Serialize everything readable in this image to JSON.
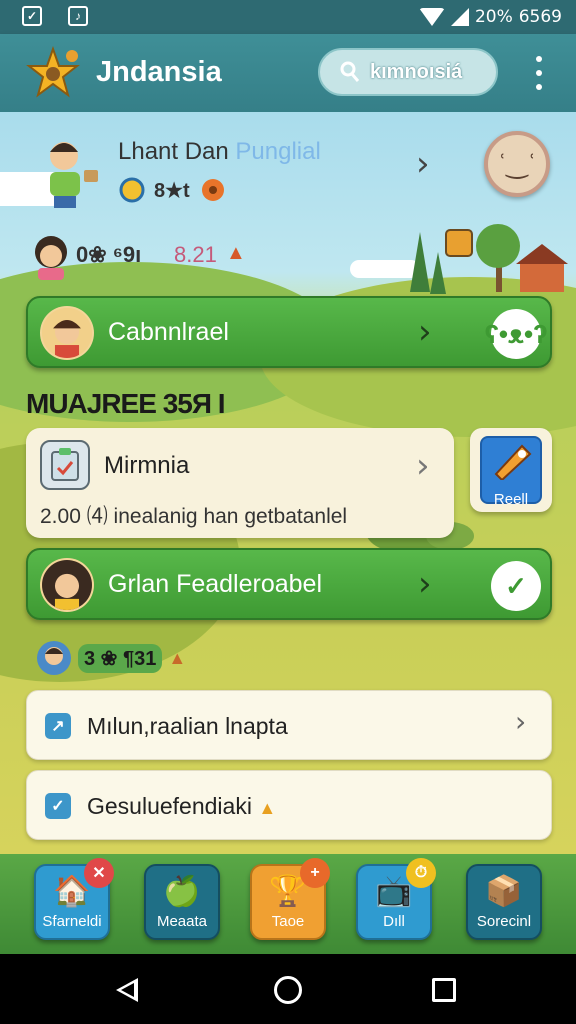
{
  "status_bar": {
    "left_icons": [
      "app-icon-a",
      "app-icon-b"
    ],
    "battery": "20%",
    "time": "6569"
  },
  "app_bar": {
    "title": "Jndansia",
    "search_label": "kımnoısiá",
    "menu_icon": "more-vert-icon"
  },
  "profile": {
    "name_main": "Lhant Dan ",
    "name_highlight": "Punglial",
    "badges_text": "8★t"
  },
  "row2": {
    "text": "0❀ ⁶9ı",
    "score": "8.21"
  },
  "cards": {
    "card1_label": "Cabnnlrael",
    "card2_label": "Grlan Feadleroabel"
  },
  "section_title": "MUAJREE 35Я I",
  "info_card": {
    "title": "Mirmnia",
    "description": "2.00 ⑷ inealanig han getbatanlel"
  },
  "side_tile": {
    "label": "Reell"
  },
  "row3": {
    "text": "3 ❀ ¶31"
  },
  "list": [
    {
      "label": "Mılun,raalian lnapta"
    },
    {
      "label": "Gesuluefendiaki"
    }
  ],
  "dock": [
    {
      "label": "Sfarneldi",
      "color": "#2f9bd0",
      "badge": "✕",
      "badge_color": "#e04848"
    },
    {
      "label": "Meaata",
      "color": "#1f6f86",
      "badge": "",
      "badge_color": ""
    },
    {
      "label": "Taoe",
      "color": "#f0a032",
      "badge": "+",
      "badge_color": "#e8692a"
    },
    {
      "label": "Dıll",
      "color": "#2f9bd0",
      "badge": "⏱",
      "badge_color": "#f0c020"
    },
    {
      "label": "Sorecinl",
      "color": "#1f6f86",
      "badge": "",
      "badge_color": ""
    }
  ],
  "colors": {
    "app_bar": "#3f8f97",
    "green_card": "#4aa83e",
    "dock": "#4e9a3e"
  }
}
